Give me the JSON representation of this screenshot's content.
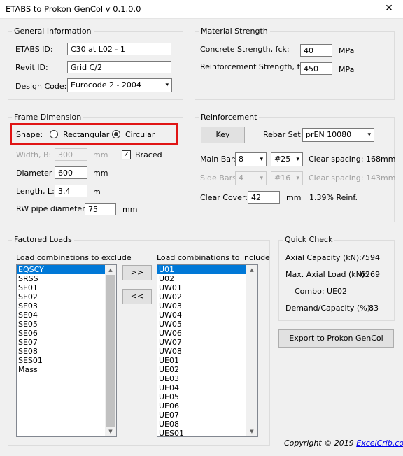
{
  "window": {
    "title": "ETABS to Prokon GenCol v 0.1.0.0",
    "close_glyph": "✕"
  },
  "general": {
    "title": "General Information",
    "etabs_id_label": "ETABS ID:",
    "etabs_id_value": "C30 at L02 - 1",
    "revit_id_label": "Revit ID:",
    "revit_id_value": "Grid C/2",
    "design_code_label": "Design Code:",
    "design_code_value": "Eurocode 2 - 2004"
  },
  "material": {
    "title": "Material Strength",
    "concrete_label": "Concrete Strength, fck:",
    "concrete_value": "40",
    "concrete_unit": "MPa",
    "reinf_label": "Reinforcement Strength, fy:",
    "reinf_value": "450",
    "reinf_unit": "MPa"
  },
  "frame": {
    "title": "Frame Dimension",
    "shape_label": "Shape:",
    "rect_label": "Rectangular",
    "rect_checked": false,
    "circ_label": "Circular",
    "circ_checked": true,
    "width_label": "Width, B:",
    "width_value": "300",
    "width_unit": "mm",
    "braced_label": "Braced",
    "braced_checked": true,
    "diameter_label": "Diameter d:",
    "diameter_value": "600",
    "diameter_unit": "mm",
    "length_label": "Length, L:",
    "length_value": "3.4",
    "length_unit": "m",
    "rw_label": "RW pipe diameter:",
    "rw_value": "75",
    "rw_unit": "mm"
  },
  "reinforcement": {
    "title": "Reinforcement",
    "key_button": "Key",
    "rebar_set_label": "Rebar Set:",
    "rebar_set_value": "prEN 10080",
    "main_bars_label": "Main Bars:",
    "main_bars_count": "8",
    "main_bars_size": "#25",
    "main_clear_spacing": "Clear spacing: 168mm",
    "side_bars_label": "Side Bars:",
    "side_bars_count": "4",
    "side_bars_size": "#16",
    "side_clear_spacing": "Clear spacing: 143mm",
    "clear_cover_label": "Clear Cover:",
    "clear_cover_value": "42",
    "clear_cover_unit": "mm",
    "reinf_percent": "1.39% Reinf."
  },
  "loads": {
    "title": "Factored Loads",
    "exclude_label": "Load combinations to exclude",
    "include_label": "Load combinations to include",
    "exclude_items": [
      "EQSCY",
      "SRSS",
      "SE01",
      "SE02",
      "SE03",
      "SE04",
      "SE05",
      "SE06",
      "SE07",
      "SE08",
      "SES01",
      "Mass"
    ],
    "include_items": [
      "U01",
      "U02",
      "UW01",
      "UW02",
      "UW03",
      "UW04",
      "UW05",
      "UW06",
      "UW07",
      "UW08",
      "UE01",
      "UE02",
      "UE03",
      "UE04",
      "UE05",
      "UE06",
      "UE07",
      "UE08",
      "UES01"
    ],
    "add_button": ">>",
    "remove_button": "<<"
  },
  "quick_check": {
    "title": "Quick Check",
    "axial_capacity_label": "Axial Capacity (kN):",
    "axial_capacity_value": "7594",
    "max_axial_label": "Max. Axial Load (kN):",
    "max_axial_value": "6269",
    "combo_text": "Combo: UE02",
    "dc_label": "Demand/Capacity (%):",
    "dc_value": "83"
  },
  "export_button": "Export to Prokon GenCol",
  "footer": {
    "copyright": "Copyright © 2019",
    "link": "ExcelCrib.com"
  },
  "icons": {
    "dropdown": "▾",
    "scroll_up": "▲",
    "scroll_down": "▼",
    "check": "✓"
  },
  "colors": {
    "selection": "#0078d7",
    "highlight_border": "#e01515",
    "link": "#0000ee"
  }
}
